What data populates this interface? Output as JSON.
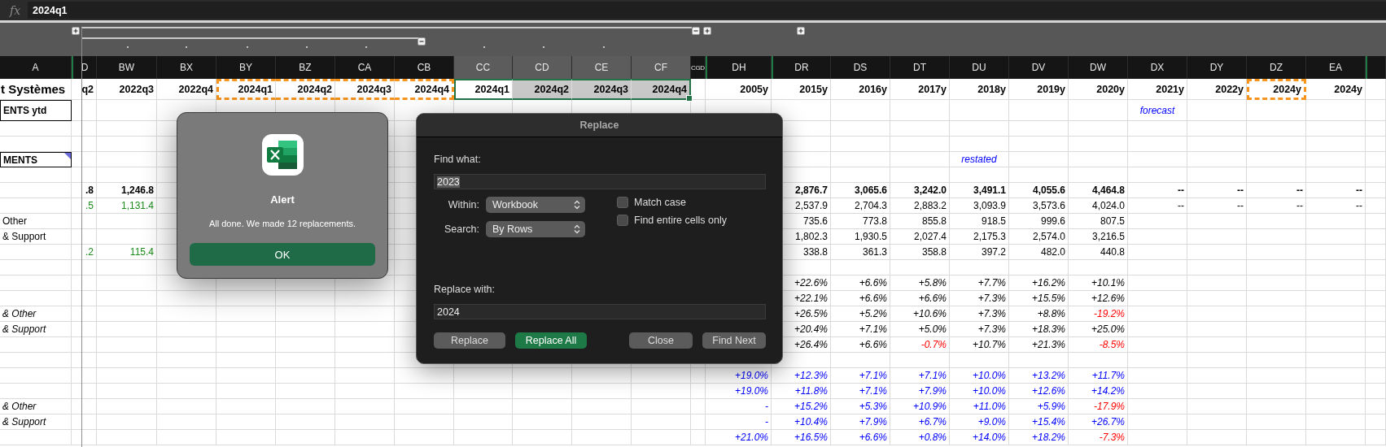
{
  "formula_bar": {
    "label": "fx",
    "value": "2024q1"
  },
  "columns": [
    {
      "label": "A",
      "selected": false,
      "hidden_before": false
    },
    {
      "label": "D",
      "selected": false,
      "hidden_before": true
    },
    {
      "label": "BW",
      "selected": false,
      "hidden_before": false
    },
    {
      "label": "BX",
      "selected": false,
      "hidden_before": false
    },
    {
      "label": "BY",
      "selected": false,
      "hidden_before": false
    },
    {
      "label": "BZ",
      "selected": false,
      "hidden_before": false
    },
    {
      "label": "CA",
      "selected": false,
      "hidden_before": false
    },
    {
      "label": "CB",
      "selected": false,
      "hidden_before": false
    },
    {
      "label": "CC",
      "selected": true,
      "hidden_before": false
    },
    {
      "label": "CD",
      "selected": true,
      "hidden_before": false
    },
    {
      "label": "CE",
      "selected": true,
      "hidden_before": false
    },
    {
      "label": "CF",
      "selected": true,
      "hidden_before": false
    },
    {
      "label": "CGD",
      "selected": false,
      "hidden_before": false
    },
    {
      "label": "DH",
      "selected": false,
      "hidden_before": true
    },
    {
      "label": "DR",
      "selected": false,
      "hidden_before": true
    },
    {
      "label": "DS",
      "selected": false,
      "hidden_before": false
    },
    {
      "label": "DT",
      "selected": false,
      "hidden_before": false
    },
    {
      "label": "DU",
      "selected": false,
      "hidden_before": false
    },
    {
      "label": "DV",
      "selected": false,
      "hidden_before": false
    },
    {
      "label": "DW",
      "selected": false,
      "hidden_before": false
    },
    {
      "label": "DX",
      "selected": false,
      "hidden_before": false
    },
    {
      "label": "DY",
      "selected": false,
      "hidden_before": false
    },
    {
      "label": "DZ",
      "selected": false,
      "hidden_before": false
    },
    {
      "label": "EA",
      "selected": false,
      "hidden_before": false
    },
    {
      "selected": false,
      "hidden_before": true
    }
  ],
  "title_row": [
    {
      "text": "t Systèmes",
      "kind": "title",
      "selected": false,
      "active": false,
      "copied": false
    },
    {
      "text": "q2",
      "selected": false,
      "active": false,
      "copied": false
    },
    {
      "text": "2022q3",
      "selected": false,
      "active": false,
      "copied": false
    },
    {
      "text": "2022q4",
      "selected": false,
      "active": false,
      "copied": false
    },
    {
      "text": "2024q1",
      "selected": false,
      "active": false,
      "copied": true
    },
    {
      "text": "2024q2",
      "selected": false,
      "active": false,
      "copied": true
    },
    {
      "text": "2024q3",
      "selected": false,
      "active": false,
      "copied": true
    },
    {
      "text": "2024q4",
      "selected": false,
      "active": false,
      "copied": true
    },
    {
      "text": "2024q1",
      "selected": true,
      "active": true,
      "copied": false
    },
    {
      "text": "2024q2",
      "selected": true,
      "active": false,
      "copied": false
    },
    {
      "text": "2024q3",
      "selected": true,
      "active": false,
      "copied": false
    },
    {
      "text": "2024q4",
      "selected": true,
      "active": false,
      "copied": false
    },
    {
      "selected": false,
      "active": false,
      "copied": false
    },
    {
      "text": "2005y",
      "selected": false,
      "active": false,
      "copied": false
    },
    {
      "text": "2015y",
      "selected": false,
      "active": false,
      "copied": false
    },
    {
      "text": "2016y",
      "selected": false,
      "active": false,
      "copied": false
    },
    {
      "text": "2017y",
      "selected": false,
      "active": false,
      "copied": false
    },
    {
      "text": "2018y",
      "selected": false,
      "active": false,
      "copied": false
    },
    {
      "text": "2019y",
      "selected": false,
      "active": false,
      "copied": false
    },
    {
      "text": "2020y",
      "selected": false,
      "active": false,
      "copied": false
    },
    {
      "text": "2021y",
      "selected": false,
      "active": false,
      "copied": false
    },
    {
      "text": "2022y",
      "selected": false,
      "active": false,
      "copied": false
    },
    {
      "text": "2024y",
      "selected": false,
      "active": false,
      "copied": true
    },
    {
      "text": "2024y",
      "selected": false,
      "active": false,
      "copied": false
    },
    {
      "selected": false,
      "active": false,
      "copied": false
    }
  ],
  "rows": [
    {
      "kind": "plain",
      "cells": [
        {
          "text": "ENTS ytd",
          "kind": "boxed"
        },
        null,
        null,
        null,
        null,
        null,
        null,
        null,
        null,
        null,
        null,
        null,
        null,
        null,
        null,
        null,
        null,
        null,
        null,
        null,
        {
          "text": "forecast",
          "kind": "note",
          "color": "#0000ff"
        },
        null,
        null,
        null,
        null
      ]
    },
    {
      "kind": "blank"
    },
    {
      "kind": "blank"
    },
    {
      "kind": "plain",
      "cells": [
        {
          "text": "MENTS",
          "kind": "boxed",
          "comment": true
        },
        null,
        null,
        null,
        null,
        null,
        null,
        null,
        null,
        null,
        null,
        null,
        null,
        null,
        null,
        null,
        null,
        {
          "text": "restated",
          "kind": "note",
          "color": "#0000ff"
        },
        null,
        null,
        null,
        null,
        null,
        null,
        null
      ]
    },
    {
      "kind": "blank"
    },
    {
      "kind": "total",
      "cells": [
        null,
        ".8",
        "1,246.8",
        null,
        null,
        null,
        null,
        null,
        null,
        null,
        null,
        null,
        null,
        null,
        "2,876.7",
        "3,065.6",
        "3,242.0",
        "3,491.1",
        "4,055.6",
        "4,464.8",
        "--",
        "--",
        "--",
        "--",
        null
      ]
    },
    {
      "kind": "plain",
      "cells": [
        null,
        {
          "text": ".5",
          "color": "#1a8c1a"
        },
        {
          "text": "1,131.4",
          "color": "#1a8c1a"
        },
        null,
        null,
        null,
        null,
        null,
        null,
        null,
        null,
        null,
        null,
        null,
        "2,537.9",
        "2,704.3",
        "2,883.2",
        "3,093.9",
        "3,573.6",
        "4,024.0",
        "--",
        "--",
        "--",
        "--",
        null
      ]
    },
    {
      "kind": "plain",
      "cells": [
        "Other",
        null,
        null,
        null,
        null,
        null,
        null,
        null,
        null,
        null,
        null,
        null,
        null,
        null,
        "735.6",
        "773.8",
        "855.8",
        "918.5",
        "999.6",
        "807.5",
        null,
        null,
        null,
        null,
        null
      ]
    },
    {
      "kind": "plain",
      "cells": [
        "& Support",
        null,
        null,
        null,
        null,
        null,
        null,
        null,
        null,
        null,
        null,
        null,
        null,
        null,
        "1,802.3",
        "1,930.5",
        "2,027.4",
        "2,175.3",
        "2,574.0",
        "3,216.5",
        null,
        null,
        null,
        null,
        null
      ]
    },
    {
      "kind": "plain",
      "cells": [
        null,
        {
          "text": ".2",
          "color": "#1a8c1a"
        },
        {
          "text": "115.4",
          "color": "#1a8c1a"
        },
        null,
        null,
        null,
        null,
        null,
        null,
        null,
        null,
        null,
        null,
        null,
        "338.8",
        "361.3",
        "358.8",
        "397.2",
        "482.0",
        "440.8",
        null,
        null,
        null,
        null,
        null
      ]
    },
    {
      "kind": "blank"
    },
    {
      "kind": "growth",
      "cells": [
        null,
        null,
        null,
        null,
        null,
        null,
        null,
        null,
        null,
        null,
        null,
        null,
        null,
        null,
        "+22.6%",
        "+6.6%",
        "+5.8%",
        "+7.7%",
        "+16.2%",
        "+10.1%",
        null,
        null,
        null,
        null,
        null
      ]
    },
    {
      "kind": "growth",
      "cells": [
        null,
        null,
        null,
        null,
        null,
        null,
        null,
        null,
        null,
        null,
        null,
        null,
        null,
        null,
        "+22.1%",
        "+6.6%",
        "+6.6%",
        "+7.3%",
        "+15.5%",
        "+12.6%",
        null,
        null,
        null,
        null,
        null
      ]
    },
    {
      "kind": "growth",
      "cells": [
        "& Other",
        null,
        null,
        null,
        null,
        null,
        null,
        null,
        null,
        null,
        null,
        null,
        null,
        null,
        "+26.5%",
        "+5.2%",
        "+10.6%",
        "+7.3%",
        "+8.8%",
        {
          "text": "-19.2%",
          "color": "#ff0000"
        },
        null,
        null,
        null,
        null,
        null
      ]
    },
    {
      "kind": "growth",
      "cells": [
        "& Support",
        null,
        null,
        null,
        null,
        null,
        null,
        null,
        null,
        null,
        null,
        null,
        null,
        null,
        "+20.4%",
        "+7.1%",
        "+5.0%",
        "+7.3%",
        "+18.3%",
        "+25.0%",
        null,
        null,
        null,
        null,
        null
      ]
    },
    {
      "kind": "growth",
      "cells": [
        null,
        null,
        null,
        null,
        null,
        null,
        null,
        null,
        null,
        null,
        null,
        null,
        null,
        null,
        "+26.4%",
        "+6.6%",
        {
          "text": "-0.7%",
          "color": "#ff0000"
        },
        "+10.7%",
        "+21.3%",
        {
          "text": "-8.5%",
          "color": "#ff0000"
        },
        null,
        null,
        null,
        null,
        null
      ]
    },
    {
      "kind": "blank"
    },
    {
      "kind": "growth_blue",
      "cells": [
        null,
        null,
        null,
        null,
        null,
        null,
        null,
        null,
        null,
        null,
        null,
        null,
        null,
        "+19.0%",
        "+12.3%",
        "+7.1%",
        "+7.1%",
        "+10.0%",
        "+13.2%",
        "+11.7%",
        null,
        null,
        null,
        null,
        null
      ]
    },
    {
      "kind": "growth_blue",
      "cells": [
        null,
        null,
        null,
        null,
        null,
        null,
        null,
        null,
        null,
        null,
        null,
        null,
        null,
        "+19.0%",
        "+11.8%",
        "+7.1%",
        "+7.9%",
        "+10.0%",
        "+12.6%",
        "+14.2%",
        null,
        null,
        null,
        null,
        null
      ]
    },
    {
      "kind": "growth_blue",
      "cells": [
        "& Other",
        null,
        null,
        null,
        null,
        null,
        null,
        null,
        null,
        null,
        null,
        null,
        null,
        "-",
        "+15.2%",
        "+5.3%",
        "+10.9%",
        "+11.0%",
        "+5.9%",
        {
          "text": "-17.9%",
          "color": "#ff0000"
        },
        null,
        null,
        null,
        null,
        null
      ]
    },
    {
      "kind": "growth_blue",
      "cells": [
        "& Support",
        null,
        null,
        null,
        null,
        null,
        null,
        null,
        null,
        null,
        null,
        null,
        null,
        "-",
        "+10.4%",
        "+7.9%",
        "+6.7%",
        "+9.0%",
        "+15.4%",
        "+26.7%",
        null,
        null,
        null,
        null,
        null
      ]
    },
    {
      "kind": "growth_blue",
      "cells": [
        null,
        null,
        null,
        null,
        null,
        null,
        null,
        null,
        null,
        null,
        null,
        null,
        null,
        "+21.0%",
        "+16.5%",
        "+6.6%",
        "+0.8%",
        "+14.0%",
        "+18.2%",
        {
          "text": "-7.3%",
          "color": "#ff0000"
        },
        null,
        null,
        null,
        null,
        null
      ]
    }
  ],
  "alert": {
    "title": "Alert",
    "message": "All done. We made 12 replacements.",
    "button": "OK"
  },
  "replace": {
    "title": "Replace",
    "find_label": "Find what:",
    "find_value": "2023",
    "find_highlighted": true,
    "options": [
      {
        "label": "Within:",
        "value": "Workbook"
      },
      {
        "label": "Search:",
        "value": "By Rows"
      }
    ],
    "checkboxes": [
      {
        "label": "Match case",
        "checked": false
      },
      {
        "label": "Find entire cells only",
        "checked": false
      }
    ],
    "replace_label": "Replace with:",
    "replace_value": "2024",
    "buttons": [
      {
        "label": "Replace",
        "default": false
      },
      {
        "label": "Replace All",
        "default": true
      },
      {
        "label": "Close",
        "default": false
      },
      {
        "label": "Find Next",
        "default": false
      }
    ]
  }
}
